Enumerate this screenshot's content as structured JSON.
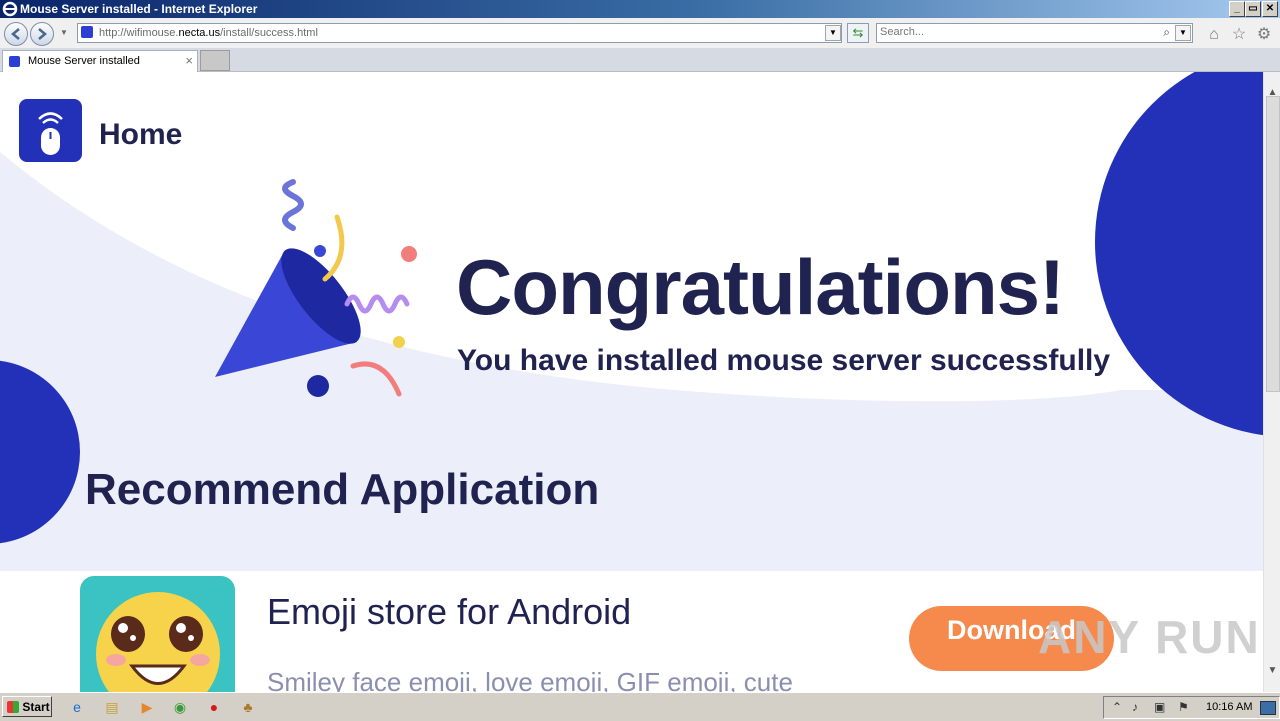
{
  "window": {
    "title": "Mouse Server installed - Internet Explorer",
    "controls": [
      "_",
      "▭",
      "✕"
    ]
  },
  "navbar": {
    "url_prefix": "http://wifimouse.",
    "url_domain": "necta.us",
    "url_path": "/install/success.html",
    "search_placeholder": "Search..."
  },
  "tabs": [
    {
      "label": "Mouse Server installed",
      "active": true
    }
  ],
  "page": {
    "home_label": "Home",
    "headline": "Congratulations!",
    "subheadline": "You have installed mouse server successfully",
    "section_title": "Recommend Application",
    "app": {
      "name": "Emoji store for Android",
      "description": "Smiley face emoji, love emoji, GIF emoji, cute",
      "button_label": "Download"
    },
    "watermark": "ANY  RUN",
    "colors": {
      "brand_blue": "#2330b8",
      "navy_text": "#20234f",
      "pale_band": "#eceff9",
      "download_orange": "#f58a4c",
      "thumb_teal": "#3ac3c2"
    }
  },
  "taskbar": {
    "start_label": "Start",
    "clock": "10:16 AM",
    "quick_launch": [
      "ie-icon",
      "explorer-icon",
      "media-player-icon",
      "chrome-icon",
      "opera-icon",
      "app-icon"
    ],
    "tray_icons": [
      "up-arrow-icon",
      "volume-icon",
      "network-icon",
      "flag-icon"
    ]
  }
}
